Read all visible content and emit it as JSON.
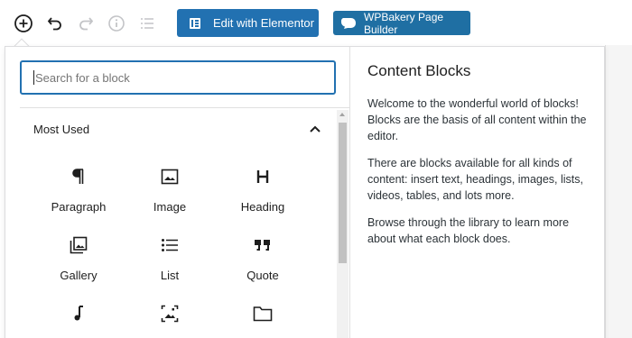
{
  "toolbar": {
    "add_block_icon": "plus-circle-icon",
    "undo_icon": "undo-icon",
    "redo_icon": "redo-icon",
    "info_icon": "info-icon",
    "list_view_icon": "list-view-icon",
    "elementor_label": "Edit with Elementor",
    "wpbakery_label": "WPBakery Page Builder"
  },
  "inserter": {
    "search_placeholder": "Search for a block",
    "section_title": "Most Used",
    "blocks": [
      {
        "label": "Paragraph",
        "icon": "paragraph-icon"
      },
      {
        "label": "Image",
        "icon": "image-icon"
      },
      {
        "label": "Heading",
        "icon": "heading-icon"
      },
      {
        "label": "Gallery",
        "icon": "gallery-icon"
      },
      {
        "label": "List",
        "icon": "list-icon"
      },
      {
        "label": "Quote",
        "icon": "quote-icon"
      },
      {
        "label": "",
        "icon": "audio-icon"
      },
      {
        "label": "",
        "icon": "cover-icon"
      },
      {
        "label": "",
        "icon": "file-icon"
      }
    ]
  },
  "help": {
    "title": "Content Blocks",
    "paragraphs": [
      "Welcome to the wonderful world of blocks! Blocks are the basis of all content within the editor.",
      "There are blocks available for all kinds of content: insert text, headings, images, lists, videos, tables, and lots more.",
      "Browse through the library to learn more about what each block does."
    ]
  },
  "colors": {
    "accent": "#2271b1",
    "wpbakery": "#1f6fa3"
  }
}
